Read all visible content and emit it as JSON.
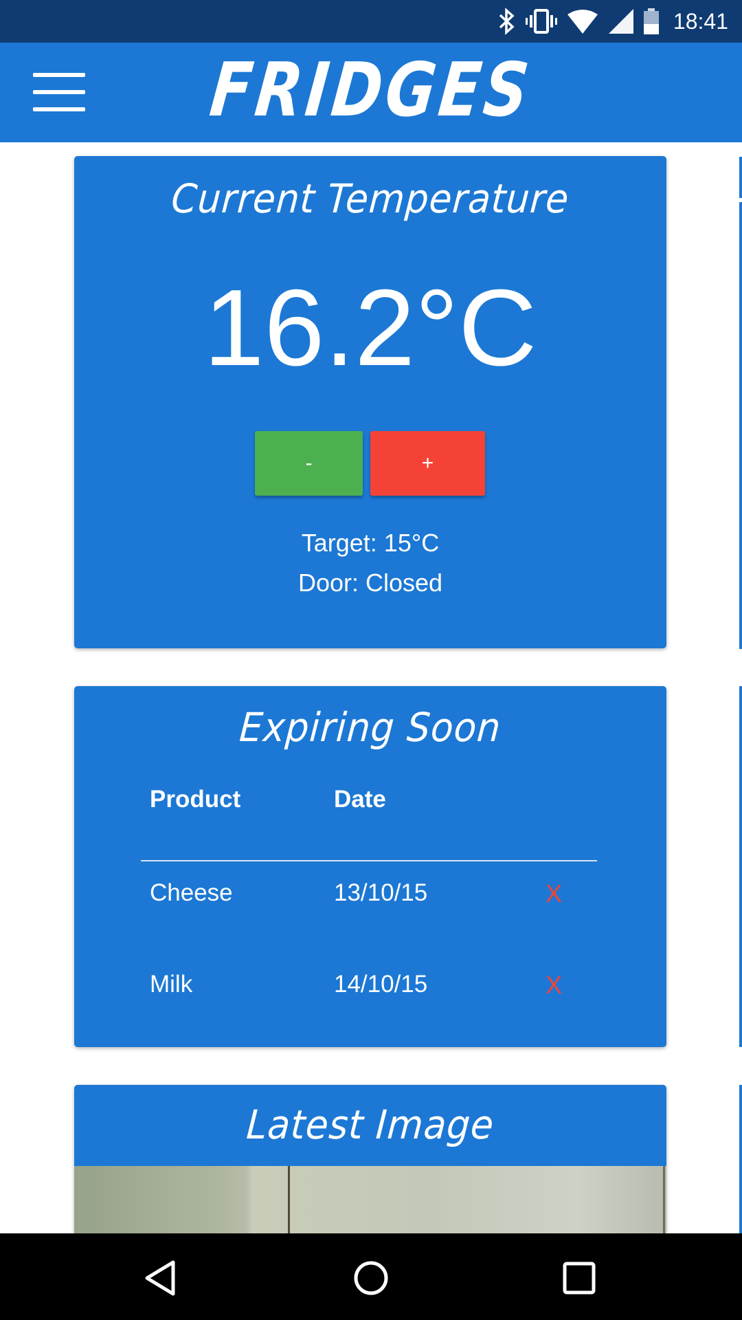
{
  "status_bar": {
    "time": "18:41",
    "icons": [
      "bluetooth-icon",
      "vibrate-icon",
      "wifi-icon",
      "signal-icon",
      "battery-icon"
    ]
  },
  "app_bar": {
    "title": "FRIDGES",
    "menu_icon": "hamburger-menu-icon"
  },
  "temperature_card": {
    "title": "Current Temperature",
    "current": "16.2°C",
    "decrease_label": "-",
    "increase_label": "+",
    "target": "Target: 15°C",
    "door": "Door: Closed"
  },
  "expiring_card": {
    "title": "Expiring Soon",
    "columns": [
      "Product",
      "Date"
    ],
    "rows": [
      {
        "product": "Cheese",
        "date": "13/10/15",
        "remove": "X"
      },
      {
        "product": "Milk",
        "date": "14/10/15",
        "remove": "X"
      }
    ]
  },
  "image_card": {
    "title": "Latest Image"
  },
  "nav_bar": {
    "buttons": [
      "back-icon",
      "home-icon",
      "recents-icon"
    ]
  },
  "colors": {
    "primary": "#1c78d4",
    "status_bar": "#0f3b72",
    "decrease_button": "#4caf50",
    "increase_button": "#f44336",
    "remove_x": "#f44336"
  }
}
